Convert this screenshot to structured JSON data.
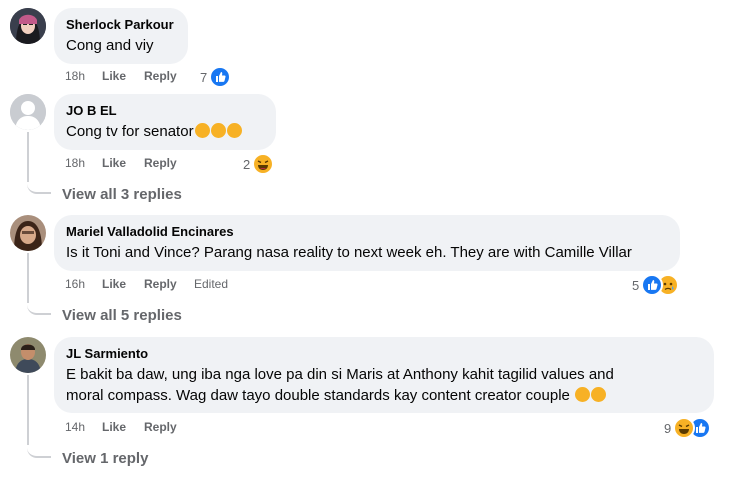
{
  "comments": [
    {
      "author": "Sherlock Parkour",
      "text": "Cong and viy",
      "time": "18h",
      "like": "Like",
      "reply": "Reply",
      "edited": "",
      "reaction_count": "7",
      "reaction_icons": [
        "like-icon"
      ]
    },
    {
      "author": "JO B EL",
      "text": "Cong tv for senator",
      "text_emojis": [
        "rolling-laughing-emoji",
        "rolling-laughing-emoji",
        "rolling-laughing-emoji"
      ],
      "time": "18h",
      "like": "Like",
      "reply": "Reply",
      "edited": "",
      "reaction_count": "2",
      "reaction_icons": [
        "haha-icon"
      ],
      "view_replies": "View all 3 replies"
    },
    {
      "author": "Mariel Valladolid Encinares",
      "text": "Is it Toni and Vince? Parang nasa reality to next week eh. They are with Camille Villar",
      "time": "16h",
      "like": "Like",
      "reply": "Reply",
      "edited": "Edited",
      "reaction_count": "5",
      "reaction_icons": [
        "like-icon",
        "sad-icon"
      ],
      "view_replies": "View all 5 replies"
    },
    {
      "author": "JL Sarmiento",
      "text_line1": "E bakit ba daw, ung iba nga love pa din si Maris at Anthony kahit tagilid values and",
      "text_line2": "moral compass. Wag daw tayo double standards kay content creator couple",
      "text_emojis": [
        "grin-sweat-emoji",
        "grin-sweat-emoji"
      ],
      "time": "14h",
      "like": "Like",
      "reply": "Reply",
      "edited": "",
      "reaction_count": "9",
      "reaction_icons": [
        "haha-icon",
        "like-icon"
      ],
      "view_replies": "View 1 reply"
    }
  ],
  "colors": {
    "bubble": "#f0f2f5",
    "meta_text": "#65676b",
    "like_blue": "#1877f2",
    "emoji_yellow": "#f7b125",
    "thread_line": "#ced0d4"
  }
}
